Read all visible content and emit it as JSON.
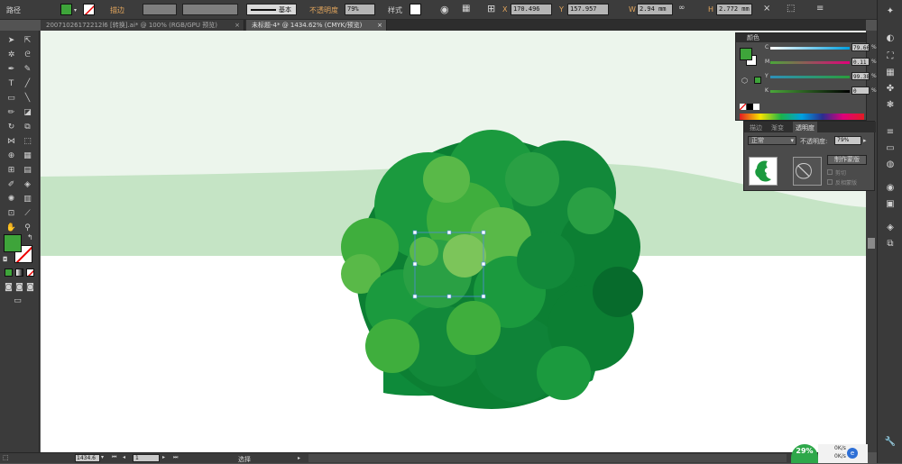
{
  "control_bar": {
    "path_label": "路径",
    "stroke_label": "描边",
    "stroke_profile": "基本",
    "opacity_label": "不透明度",
    "opacity_value": "79%",
    "style_label": "样式",
    "x_value": "170.496",
    "y_value": "157.957",
    "w_value": "2.94 mm",
    "h_value": "2.772 mm",
    "fill_color": "#3ea43a"
  },
  "tabs": [
    {
      "label": "20071026172212l6 [转换].ai* @ 100% (RGB/GPU 预览)"
    },
    {
      "label": "未标题-4* @ 1434.62% (CMYK/预览)"
    }
  ],
  "color_panel": {
    "title": "颜色",
    "channels": [
      {
        "name": "C",
        "value": "79.66",
        "gradient": "linear-gradient(90deg,#ffffff,#00a0e0)"
      },
      {
        "name": "M",
        "value": "0.11",
        "gradient": "linear-gradient(90deg,#4aa63a,#e0007a)"
      },
      {
        "name": "Y",
        "value": "99.38",
        "gradient": "linear-gradient(90deg,#2e8fb8,#2a9d3c)"
      },
      {
        "name": "K",
        "value": "0",
        "gradient": "linear-gradient(90deg,#4aa63a,#000000)"
      }
    ],
    "pct_sign": "%"
  },
  "transparency_panel": {
    "tab_stroke": "描边",
    "tab_gradient": "渐变",
    "tab_transparency": "透明度",
    "blend_mode": "正常",
    "opacity_label": "不透明度:",
    "opacity_value": "79%",
    "make_mask_button": "制作蒙版",
    "clip_label": "剪切",
    "invert_mask_label": "反相蒙版"
  },
  "status_bar": {
    "zoom": "1434.6",
    "page": "1",
    "tool": "选择"
  },
  "tray": {
    "cpu_percent": "29%",
    "net_up": "0K/s",
    "net_down": "0K/s"
  }
}
